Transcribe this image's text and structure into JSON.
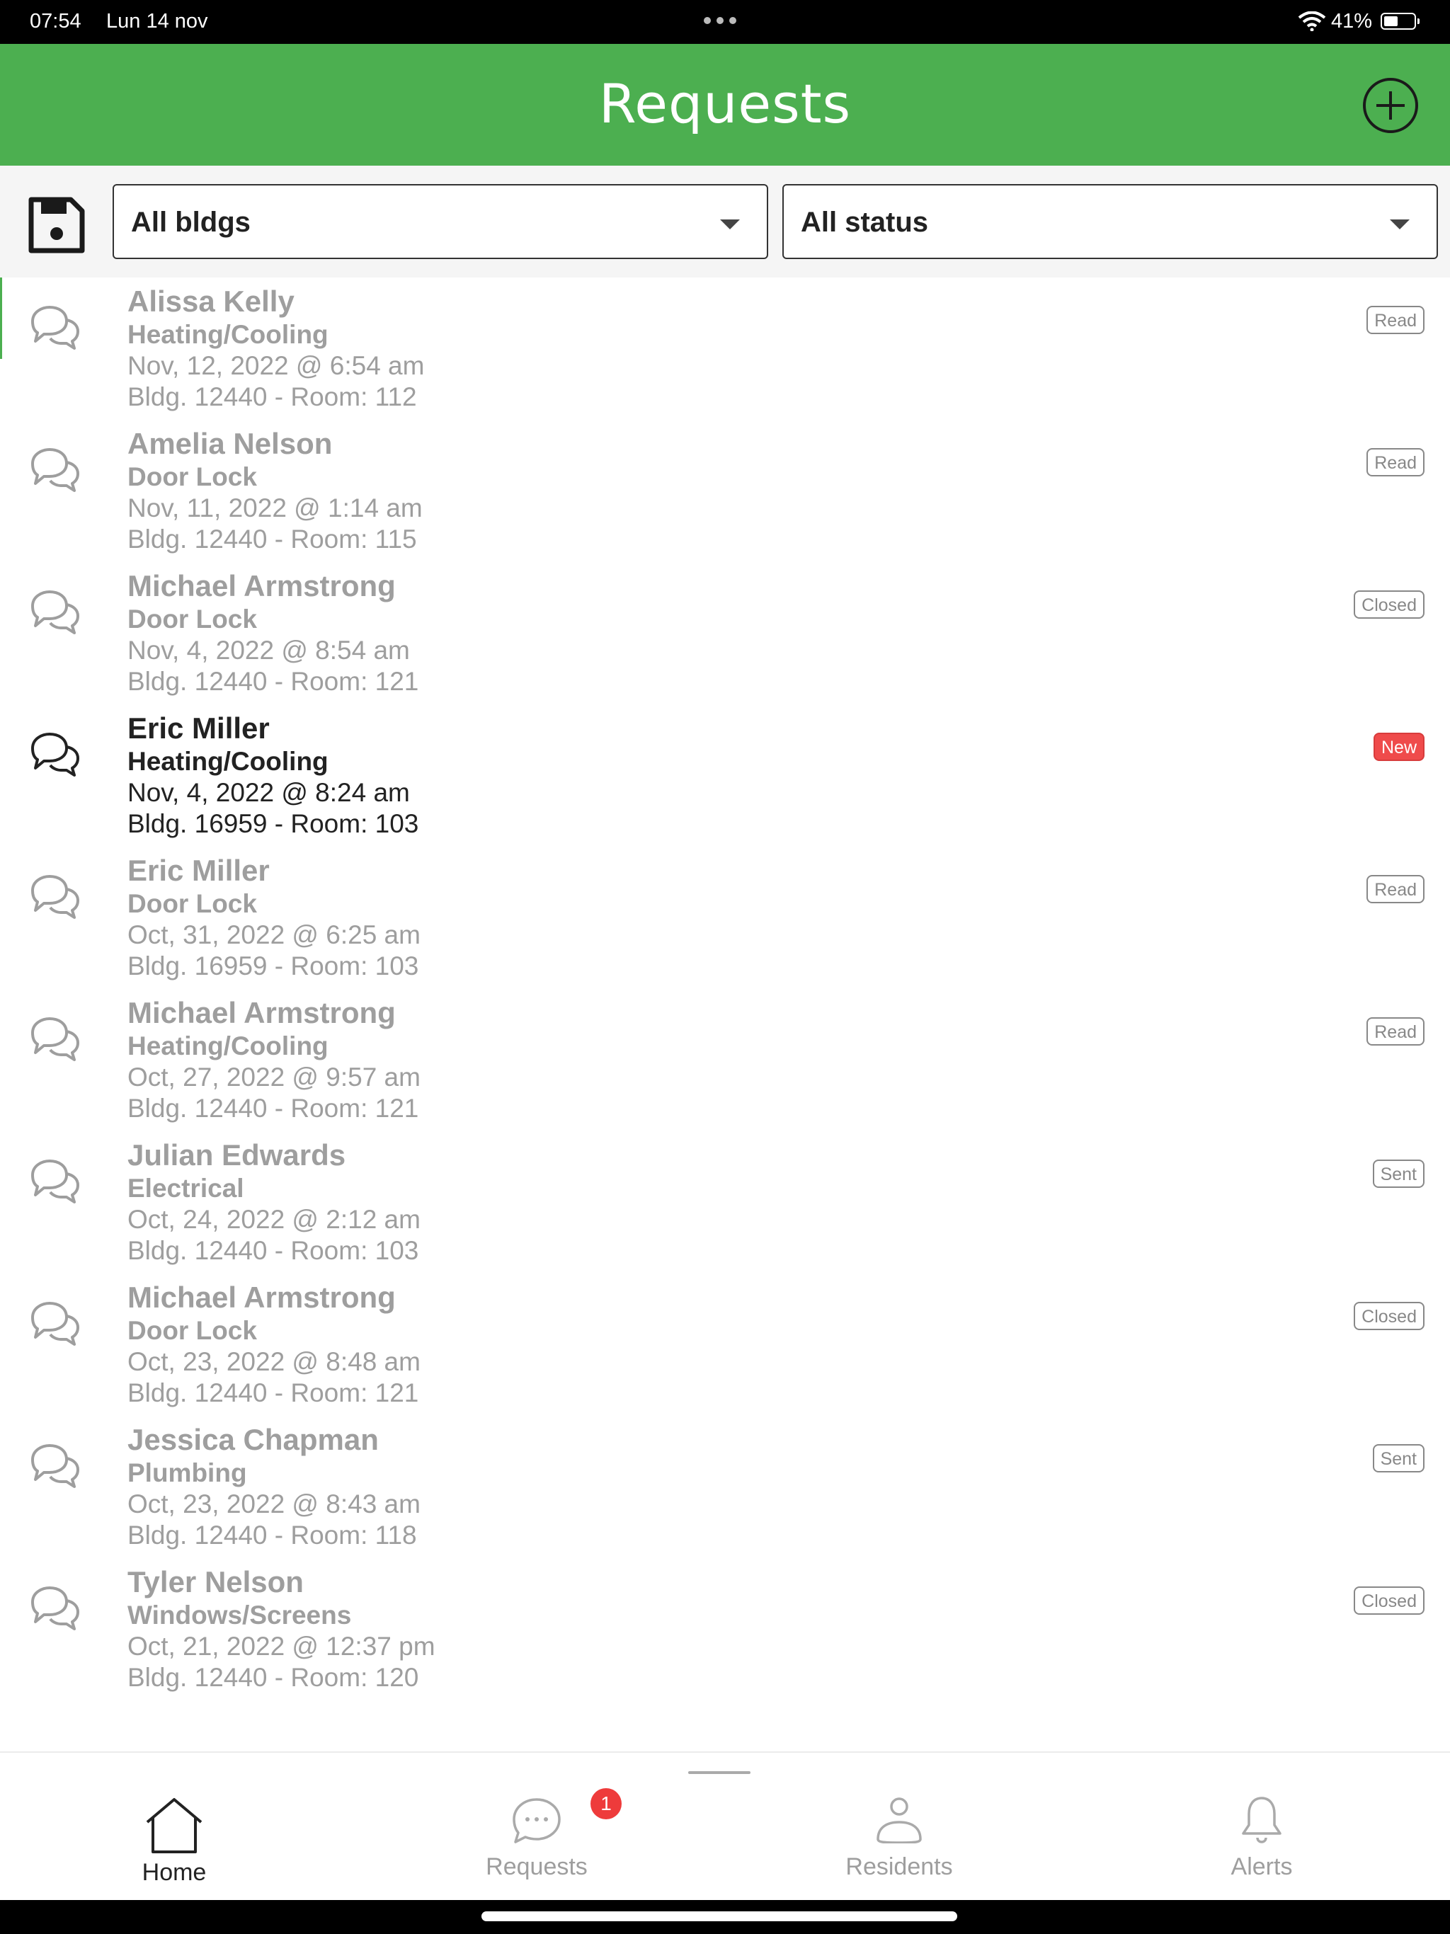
{
  "status_bar": {
    "time": "07:54",
    "date": "Lun 14 nov",
    "battery": "41%"
  },
  "header": {
    "title": "Requests"
  },
  "filters": {
    "building": "All bldgs",
    "status": "All status"
  },
  "requests": [
    {
      "name": "Alissa Kelly",
      "category": "Heating/Cooling",
      "date": "Nov, 12, 2022 @ 6:54 am",
      "location": "Bldg. 12440 - Room: 112",
      "status": "Read"
    },
    {
      "name": "Amelia Nelson",
      "category": "Door Lock",
      "date": "Nov, 11, 2022 @ 1:14 am",
      "location": "Bldg. 12440 - Room: 115",
      "status": "Read"
    },
    {
      "name": "Michael Armstrong",
      "category": "Door Lock",
      "date": "Nov, 4, 2022 @ 8:54 am",
      "location": "Bldg. 12440 - Room: 121",
      "status": "Closed"
    },
    {
      "name": "Eric Miller",
      "category": "Heating/Cooling",
      "date": "Nov, 4, 2022 @ 8:24 am",
      "location": "Bldg. 16959 - Room: 103",
      "status": "New"
    },
    {
      "name": "Eric Miller",
      "category": "Door Lock",
      "date": "Oct, 31, 2022 @ 6:25 am",
      "location": "Bldg. 16959 - Room: 103",
      "status": "Read"
    },
    {
      "name": "Michael Armstrong",
      "category": "Heating/Cooling",
      "date": "Oct, 27, 2022 @ 9:57 am",
      "location": "Bldg. 12440 - Room: 121",
      "status": "Read"
    },
    {
      "name": "Julian Edwards",
      "category": "Electrical",
      "date": "Oct, 24, 2022 @ 2:12 am",
      "location": "Bldg. 12440 - Room: 103",
      "status": "Sent"
    },
    {
      "name": "Michael Armstrong",
      "category": "Door Lock",
      "date": "Oct, 23, 2022 @ 8:48 am",
      "location": "Bldg. 12440 - Room: 121",
      "status": "Closed"
    },
    {
      "name": "Jessica Chapman",
      "category": "Plumbing",
      "date": "Oct, 23, 2022 @ 8:43 am",
      "location": "Bldg. 12440 - Room: 118",
      "status": "Sent"
    },
    {
      "name": "Tyler Nelson",
      "category": "Windows/Screens",
      "date": "Oct, 21, 2022 @ 12:37 pm",
      "location": "Bldg. 12440 - Room: 120",
      "status": "Closed"
    }
  ],
  "nav": {
    "home": "Home",
    "requests": "Requests",
    "requests_badge": "1",
    "residents": "Residents",
    "alerts": "Alerts"
  },
  "colors": {
    "accent": "#4caf50",
    "badge_new": "#ef4b4b"
  }
}
